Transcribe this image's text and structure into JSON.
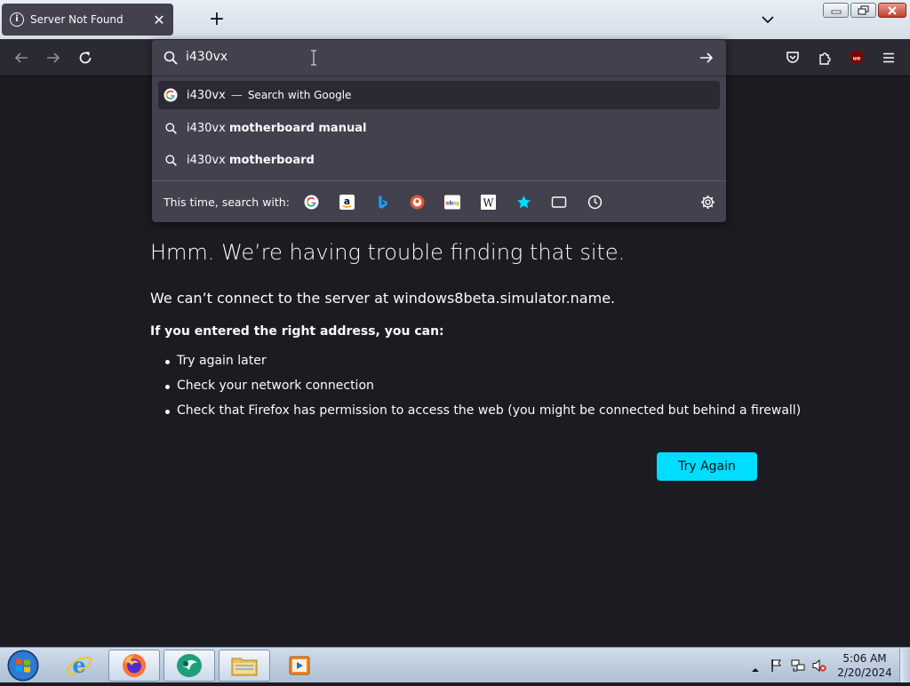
{
  "tab": {
    "title": "Server Not Found",
    "info_glyph": "i",
    "close_glyph": "✕"
  },
  "tabstrip": {
    "new_tab_glyph": "+"
  },
  "urlbar": {
    "value": "i430vx",
    "results": [
      {
        "query": "i430vx",
        "dash": "—",
        "action": "Search with Google",
        "icon": "google-icon",
        "selected": true
      },
      {
        "query": "i430vx",
        "suggestion": "motherboard manual",
        "icon": "search-icon"
      },
      {
        "query": "i430vx",
        "suggestion": "motherboard",
        "icon": "search-icon"
      }
    ],
    "oneoff_label": "This time, search with:",
    "oneoff_engines": [
      "google-icon",
      "amazon-icon",
      "bing-icon",
      "duckduckgo-icon",
      "ebay-icon",
      "wikipedia-icon",
      "bookmarks-icon",
      "tabs-icon",
      "history-icon"
    ]
  },
  "page": {
    "title": "Hmm. We’re having trouble finding that site.",
    "description": "We can’t connect to the server at windows8beta.simulator.name.",
    "intro": "If you entered the right address, you can:",
    "suggestions": [
      "Try again later",
      "Check your network connection",
      "Check that Firefox has permission to access the web (you might be connected but behind a firewall)"
    ],
    "button": "Try Again"
  },
  "taskbar": {
    "time": "5:06 AM",
    "date": "2/20/2024",
    "pinned": [
      "internet-explorer-icon",
      "firefox-icon",
      "app-icon",
      "file-explorer-icon",
      "media-player-icon"
    ]
  },
  "colors": {
    "accent": "#00ddff",
    "page_bg": "#1c1b22",
    "toolbar_bg": "#2b2a33",
    "popup_bg": "#42414d"
  }
}
